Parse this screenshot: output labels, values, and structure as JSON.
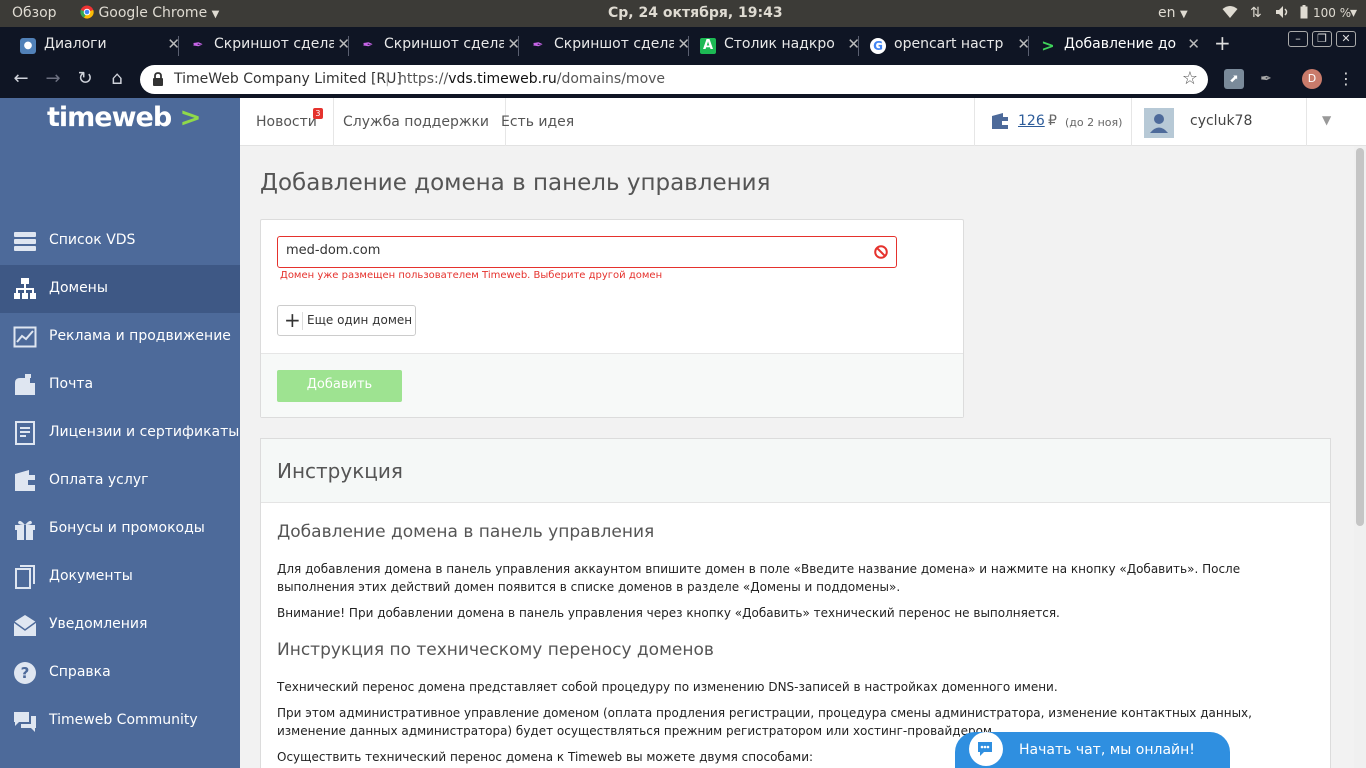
{
  "os_panel": {
    "overview": "Обзор",
    "app_name": "Google Chrome",
    "clock": "Ср, 24 октября, 19:43",
    "lang": "en",
    "battery": "100 %"
  },
  "tabs": [
    {
      "title": "Диалоги",
      "icon": "vk-icon"
    },
    {
      "title": "Скриншот сдела",
      "icon": "feather-icon"
    },
    {
      "title": "Скриншот сдела",
      "icon": "feather-icon"
    },
    {
      "title": "Скриншот сдела",
      "icon": "feather-icon"
    },
    {
      "title": "Столик надкро",
      "icon": "letter-a-icon"
    },
    {
      "title": "opencart настр",
      "icon": "google-icon"
    },
    {
      "title": "Добавление до",
      "icon": "timeweb-arrow-icon"
    }
  ],
  "new_tab": "+",
  "omnibox": {
    "site_name": "TimeWeb Company Limited [RU]",
    "separator": "|",
    "url_scheme": "https://",
    "url_host": "vds.timeweb.ru",
    "url_path": "/domains/move"
  },
  "profile_letter": "D",
  "header": {
    "logo": "timeweb",
    "logo_arrow": ">",
    "nav": [
      {
        "label": "Новости",
        "badge": "3"
      },
      {
        "label": "Служба поддержки"
      },
      {
        "label": "Есть идея"
      }
    ],
    "balance_amount": "126",
    "balance_currency": "₽",
    "balance_until": "(до 2 ноя)",
    "username": "cycluk78"
  },
  "sidebar": {
    "items": [
      {
        "label": "Список VDS",
        "icon": "servers-icon"
      },
      {
        "label": "Домены",
        "icon": "sitemap-icon",
        "active": true
      },
      {
        "label": "Реклама и продвижение",
        "icon": "chart-icon"
      },
      {
        "label": "Почта",
        "icon": "mailbox-icon"
      },
      {
        "label": "Лицензии и сертификаты",
        "icon": "certificate-icon"
      },
      {
        "label": "Оплата услуг",
        "icon": "wallet-icon"
      },
      {
        "label": "Бонусы и промокоды",
        "icon": "gift-icon"
      },
      {
        "label": "Документы",
        "icon": "documents-icon"
      },
      {
        "label": "Уведомления",
        "icon": "envelope-icon"
      },
      {
        "label": "Справка",
        "icon": "help-icon"
      },
      {
        "label": "Timeweb Community",
        "icon": "community-icon"
      }
    ]
  },
  "main": {
    "title": "Добавление домена в панель управления",
    "domain_value": "med-dom.com",
    "error": "Домен уже размещен пользователем Timeweb. Выберите другой домен",
    "add_more": "Еще один домен",
    "submit": "Добавить"
  },
  "instructions": {
    "title": "Инструкция",
    "h1": "Добавление домена в панель управления",
    "p1": "Для добавления домена в панель управления аккаунтом впишите домен в поле «Введите название домена» и нажмите на кнопку «Добавить». После выполнения этих действий домен появится в списке доменов в разделе «Домены и поддомены».",
    "p2": "Внимание! При добавлении домена в панель управления через кнопку «Добавить» технический перенос не выполняется.",
    "h2": "Инструкция по техническому переносу доменов",
    "p3": "Технический перенос домена представляет собой процедуру по изменению DNS-записей в настройках доменного имени.",
    "p4": "При этом административное управление доменом (оплата продления регистрации, процедура смены администратора, изменение контактных данных, изменение данных администратора) будет осуществляться прежним регистратором или хостинг-провайдером.",
    "p5": "Осуществить технический перенос домена к Timeweb вы можете двумя способами:"
  },
  "chat": {
    "label": "Начать чат, мы онлайн!"
  },
  "colors": {
    "sidebar": "#4d6a9a",
    "sidebar_active": "#3e5885",
    "error": "#e5322d",
    "submit": "#9ee391",
    "chat": "#2f8fe0",
    "logo_arrow": "#8fd94a"
  }
}
